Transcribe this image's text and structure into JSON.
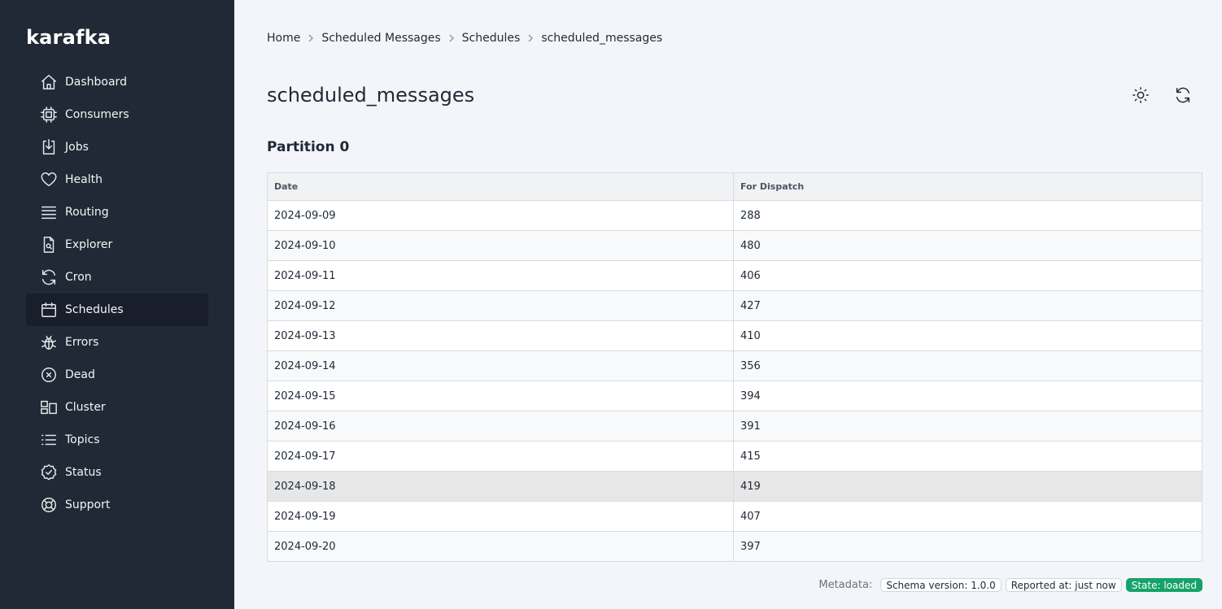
{
  "app": {
    "logo": "karafka"
  },
  "sidebar": {
    "items": [
      {
        "label": "Dashboard",
        "icon": "home-icon"
      },
      {
        "label": "Consumers",
        "icon": "cpu-icon"
      },
      {
        "label": "Jobs",
        "icon": "download-doc-icon"
      },
      {
        "label": "Health",
        "icon": "heart-icon"
      },
      {
        "label": "Routing",
        "icon": "stack-icon"
      },
      {
        "label": "Explorer",
        "icon": "file-search-icon"
      },
      {
        "label": "Cron",
        "icon": "refresh-icon"
      },
      {
        "label": "Schedules",
        "icon": "calendar-icon",
        "active": true
      },
      {
        "label": "Errors",
        "icon": "bug-icon"
      },
      {
        "label": "Dead",
        "icon": "x-circle-icon"
      },
      {
        "label": "Cluster",
        "icon": "cluster-icon"
      },
      {
        "label": "Topics",
        "icon": "list-icon"
      },
      {
        "label": "Status",
        "icon": "check-badge-icon"
      },
      {
        "label": "Support",
        "icon": "lifebuoy-icon"
      }
    ]
  },
  "breadcrumb": [
    "Home",
    "Scheduled Messages",
    "Schedules",
    "scheduled_messages"
  ],
  "page": {
    "title": "scheduled_messages",
    "section_title": "Partition 0"
  },
  "toolbar": {
    "theme_icon": "sun-icon",
    "refresh_icon": "refresh-icon"
  },
  "table": {
    "headers": [
      "Date",
      "For Dispatch"
    ],
    "rows": [
      [
        "2024-09-09",
        "288"
      ],
      [
        "2024-09-10",
        "480"
      ],
      [
        "2024-09-11",
        "406"
      ],
      [
        "2024-09-12",
        "427"
      ],
      [
        "2024-09-13",
        "410"
      ],
      [
        "2024-09-14",
        "356"
      ],
      [
        "2024-09-15",
        "394"
      ],
      [
        "2024-09-16",
        "391"
      ],
      [
        "2024-09-17",
        "415"
      ],
      [
        "2024-09-18",
        "419"
      ],
      [
        "2024-09-19",
        "407"
      ],
      [
        "2024-09-20",
        "397"
      ]
    ]
  },
  "footer": {
    "label": "Metadata:",
    "schema": "Schema version: 1.0.0",
    "reported": "Reported at: just now",
    "state": "State: loaded"
  },
  "colors": {
    "sidebar_bg": "#212936",
    "active_item_bg": "#181e2b",
    "page_bg": "#f4f5fa",
    "success": "#16a36b"
  }
}
